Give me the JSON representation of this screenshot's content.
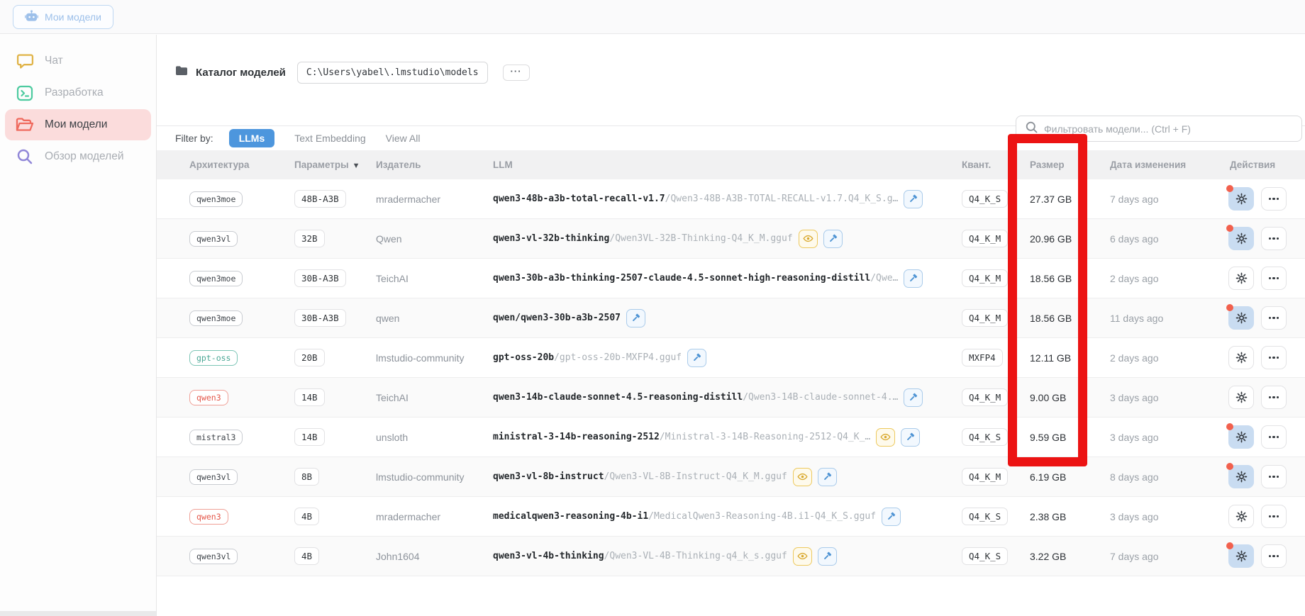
{
  "topbar": {
    "model_button_label": "Мои модели"
  },
  "sidebar": {
    "items": [
      {
        "label": "Чат",
        "icon": "chat-icon",
        "active": false
      },
      {
        "label": "Разработка",
        "icon": "terminal-icon",
        "active": false
      },
      {
        "label": "Мои модели",
        "icon": "open-folder-icon",
        "active": true
      },
      {
        "label": "Обзор моделей",
        "icon": "search-icon",
        "active": false
      }
    ]
  },
  "catalog": {
    "label": "Каталог моделей",
    "path": "C:\\Users\\yabel\\.lmstudio\\models",
    "more_label": "···"
  },
  "filter": {
    "label": "Filter by:",
    "tabs": [
      {
        "label": "LLMs",
        "active": true
      },
      {
        "label": "Text Embedding",
        "active": false
      },
      {
        "label": "View All",
        "active": false
      }
    ],
    "search_placeholder": "Фильтровать модели... (Ctrl + F)"
  },
  "table": {
    "columns": {
      "architecture": "Архитектура",
      "params": "Параметры",
      "publisher": "Издатель",
      "llm": "LLM",
      "quant": "Квант.",
      "size": "Размер",
      "modified": "Дата изменения",
      "actions": "Действия"
    },
    "sort_indicator": "▼",
    "rows": [
      {
        "arch": "qwen3moe",
        "arch_style": "default",
        "params": "48B-A3B",
        "publisher": "mradermacher",
        "name": "qwen3-48b-a3b-total-recall-v1.7",
        "file": "/Qwen3-48B-A3B-TOTAL-RECALL-v1.7.Q4_K_S.g…",
        "vision": false,
        "tools": true,
        "quant": "Q4_K_S",
        "size": "27.37 GB",
        "modified": "7 days ago",
        "update_available": true
      },
      {
        "arch": "qwen3vl",
        "arch_style": "default",
        "params": "32B",
        "publisher": "Qwen",
        "name": "qwen3-vl-32b-thinking",
        "file": "/Qwen3VL-32B-Thinking-Q4_K_M.gguf",
        "vision": true,
        "tools": true,
        "quant": "Q4_K_M",
        "size": "20.96 GB",
        "modified": "6 days ago",
        "update_available": true
      },
      {
        "arch": "qwen3moe",
        "arch_style": "default",
        "params": "30B-A3B",
        "publisher": "TeichAI",
        "name": "qwen3-30b-a3b-thinking-2507-claude-4.5-sonnet-high-reasoning-distill",
        "file": "/Qwe…",
        "vision": false,
        "tools": true,
        "quant": "Q4_K_M",
        "size": "18.56 GB",
        "modified": "2 days ago",
        "update_available": false
      },
      {
        "arch": "qwen3moe",
        "arch_style": "default",
        "params": "30B-A3B",
        "publisher": "qwen",
        "name": "qwen/qwen3-30b-a3b-2507",
        "file": "",
        "vision": false,
        "tools": true,
        "quant": "Q4_K_M",
        "size": "18.56 GB",
        "modified": "11 days ago",
        "update_available": true
      },
      {
        "arch": "gpt-oss",
        "arch_style": "teal",
        "params": "20B",
        "publisher": "lmstudio-community",
        "name": "gpt-oss-20b",
        "file": "/gpt-oss-20b-MXFP4.gguf",
        "vision": false,
        "tools": true,
        "quant": "MXFP4",
        "size": "12.11 GB",
        "modified": "2 days ago",
        "update_available": false
      },
      {
        "arch": "qwen3",
        "arch_style": "red",
        "params": "14B",
        "publisher": "TeichAI",
        "name": "qwen3-14b-claude-sonnet-4.5-reasoning-distill",
        "file": "/Qwen3-14B-claude-sonnet-4.…",
        "vision": false,
        "tools": true,
        "quant": "Q4_K_M",
        "size": "9.00 GB",
        "modified": "3 days ago",
        "update_available": false
      },
      {
        "arch": "mistral3",
        "arch_style": "default",
        "params": "14B",
        "publisher": "unsloth",
        "name": "ministral-3-14b-reasoning-2512",
        "file": "/Ministral-3-14B-Reasoning-2512-Q4_K_…",
        "vision": true,
        "tools": true,
        "quant": "Q4_K_S",
        "size": "9.59 GB",
        "modified": "3 days ago",
        "update_available": true
      },
      {
        "arch": "qwen3vl",
        "arch_style": "default",
        "params": "8B",
        "publisher": "lmstudio-community",
        "name": "qwen3-vl-8b-instruct",
        "file": "/Qwen3-VL-8B-Instruct-Q4_K_M.gguf",
        "vision": true,
        "tools": true,
        "quant": "Q4_K_M",
        "size": "6.19 GB",
        "modified": "8 days ago",
        "update_available": true
      },
      {
        "arch": "qwen3",
        "arch_style": "red",
        "params": "4B",
        "publisher": "mradermacher",
        "name": "medicalqwen3-reasoning-4b-i1",
        "file": "/MedicalQwen3-Reasoning-4B.i1-Q4_K_S.gguf",
        "vision": false,
        "tools": true,
        "quant": "Q4_K_S",
        "size": "2.38 GB",
        "modified": "3 days ago",
        "update_available": false
      },
      {
        "arch": "qwen3vl",
        "arch_style": "default",
        "params": "4B",
        "publisher": "John1604",
        "name": "qwen3-vl-4b-thinking",
        "file": "/Qwen3-VL-4B-Thinking-q4_k_s.gguf",
        "vision": true,
        "tools": true,
        "quant": "Q4_K_S",
        "size": "3.22 GB",
        "modified": "7 days ago",
        "update_available": true
      }
    ]
  },
  "annotation": {
    "shape": "rectangle",
    "highlighted_column": "Размер",
    "color": "#ec1313"
  },
  "colors": {
    "accent_blue": "#4d96dd",
    "active_sidebar_bg": "#fbdcdc",
    "update_dot": "#f2604d",
    "update_button_bg": "#c9dcf1",
    "annotation_red": "#ec1313"
  }
}
